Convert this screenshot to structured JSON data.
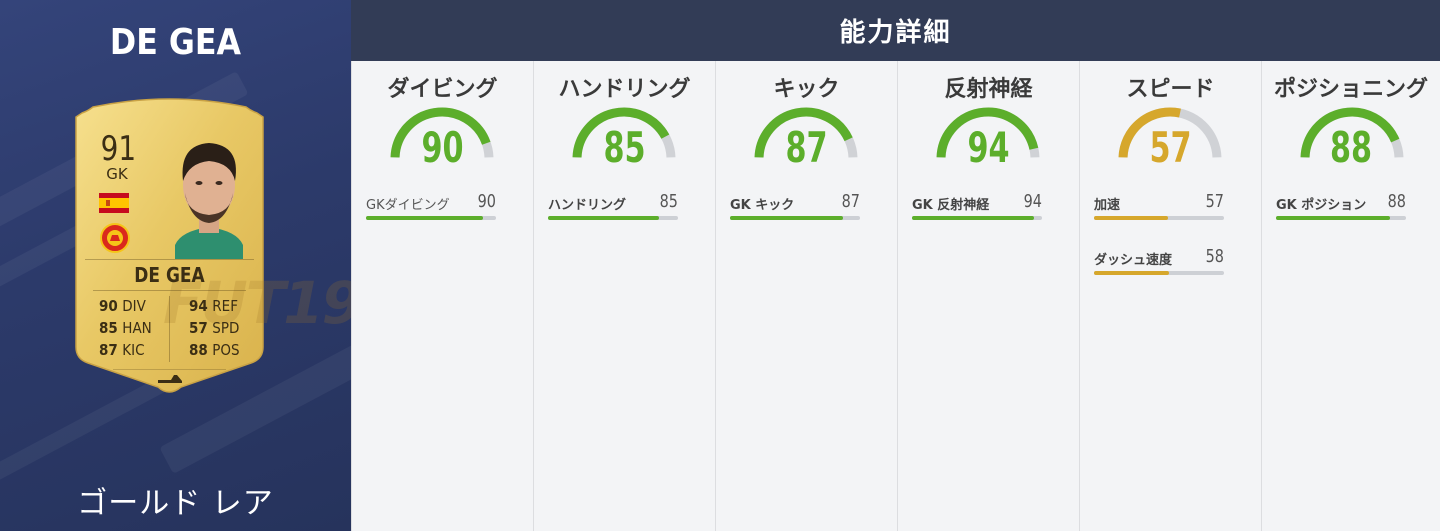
{
  "player": {
    "name": "DE GEA",
    "rarity": "ゴールド レア",
    "card": {
      "rating": "91",
      "position": "GK",
      "name": "DE GEA",
      "watermark": "FUT19",
      "stats": {
        "div": "90",
        "div_label": "DIV",
        "han": "85",
        "han_label": "HAN",
        "kic": "87",
        "kic_label": "KIC",
        "ref": "94",
        "ref_label": "REF",
        "spd": "57",
        "spd_label": "SPD",
        "pos": "88",
        "pos_label": "POS"
      }
    }
  },
  "detail": {
    "title": "能力詳細",
    "colors": {
      "high": "#5cae2b",
      "mid": "#d6a72c",
      "track": "#d0d2d6"
    },
    "columns": [
      {
        "title": "ダイビング",
        "value": 90,
        "level": "high",
        "sub": [
          {
            "label": "GKダイビング",
            "value": 90,
            "bold": false
          }
        ]
      },
      {
        "title": "ハンドリング",
        "value": 85,
        "level": "high",
        "sub": [
          {
            "label": "ハンドリング",
            "value": 85,
            "bold": true
          }
        ]
      },
      {
        "title": "キック",
        "value": 87,
        "level": "high",
        "sub": [
          {
            "label": "GK キック",
            "value": 87,
            "bold": true
          }
        ]
      },
      {
        "title": "反射神経",
        "value": 94,
        "level": "high",
        "sub": [
          {
            "label": "GK 反射神経",
            "value": 94,
            "bold": true
          }
        ]
      },
      {
        "title": "スピード",
        "value": 57,
        "level": "mid",
        "sub": [
          {
            "label": "加速",
            "value": 57,
            "bold": true
          },
          {
            "label": "ダッシュ速度",
            "value": 58,
            "bold": true
          }
        ]
      },
      {
        "title": "ポジショニング",
        "value": 88,
        "level": "high",
        "sub": [
          {
            "label": "GK ポジション",
            "value": 88,
            "bold": true
          }
        ]
      }
    ]
  }
}
